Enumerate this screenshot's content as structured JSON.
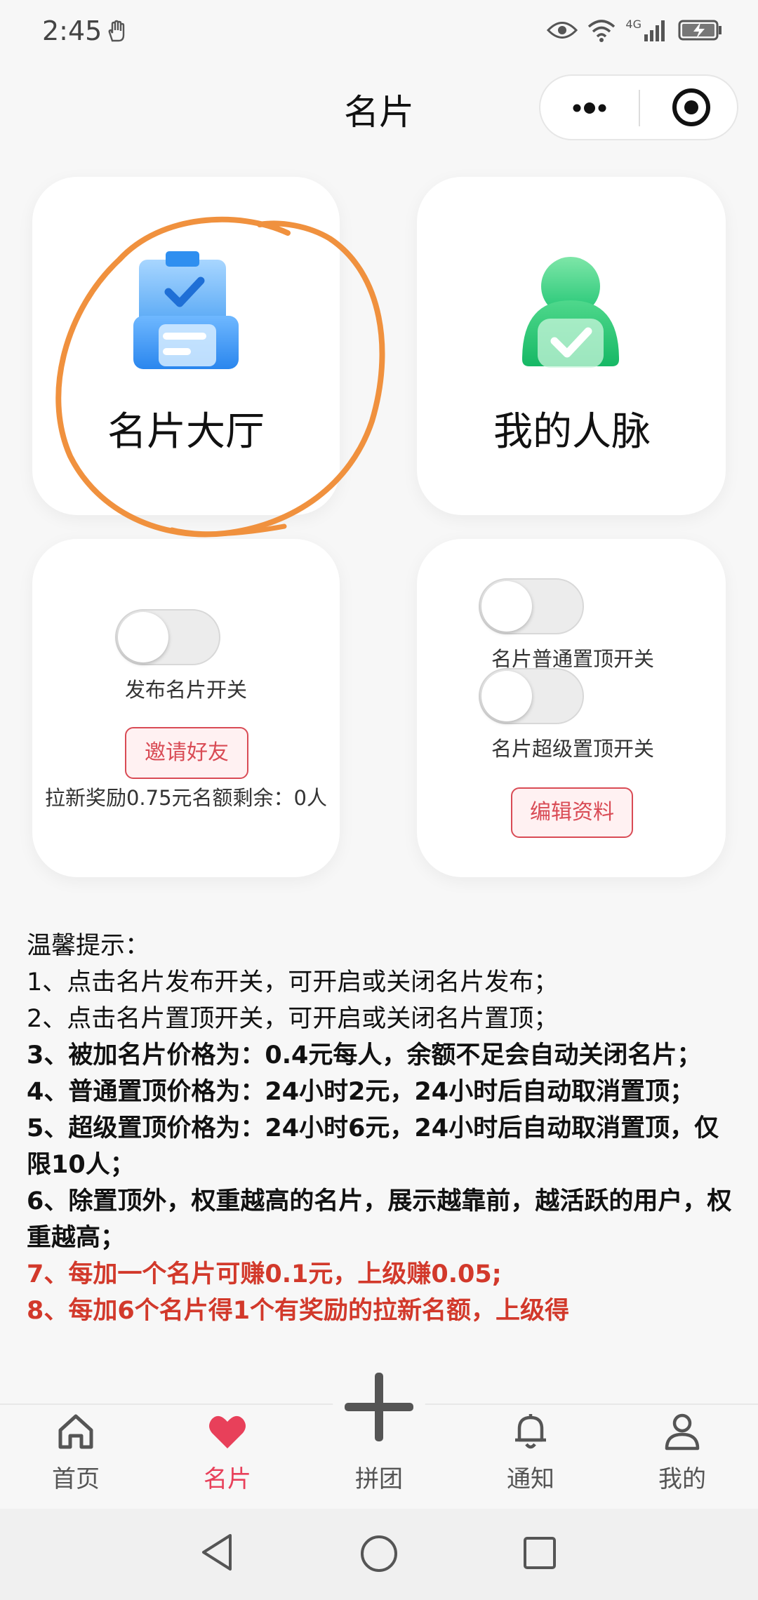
{
  "status": {
    "time": "2:45",
    "network": "4G"
  },
  "title": "名片",
  "cards": {
    "hall_label": "名片大厅",
    "network_label": "我的人脉",
    "publish_toggle_label": "发布名片开关",
    "publish_toggle_on": false,
    "invite_button": "邀请好友",
    "invite_reward_text": "拉新奖励0.75元名额剩余：0人",
    "normal_pin_label": "名片普通置顶开关",
    "normal_pin_on": false,
    "super_pin_label": "名片超级置顶开关",
    "super_pin_on": false,
    "edit_button": "编辑资料"
  },
  "tips": {
    "heading": "温馨提示：",
    "lines": [
      "1、点击名片发布开关，可开启或关闭名片发布；",
      "2、点击名片置顶开关，可开启或关闭名片置顶；",
      "3、被加名片价格为：0.4元每人，余额不足会自动关闭名片；",
      "4、普通置顶价格为：24小时2元，24小时后自动取消置顶；",
      "5、超级置顶价格为：24小时6元，24小时后自动取消置顶，仅限10人；",
      "6、除置顶外，权重越高的名片，展示越靠前，越活跃的用户，权重越高；",
      "7、每加一个名片可赚0.1元，上级赚0.05;",
      "8、每加6个名片得1个有奖励的拉新名额，上级得"
    ]
  },
  "tabs": [
    {
      "label": "首页",
      "icon": "home-icon"
    },
    {
      "label": "名片",
      "icon": "heart-icon",
      "active": true
    },
    {
      "label": "拼团",
      "icon": "plus-icon"
    },
    {
      "label": "通知",
      "icon": "bell-icon"
    },
    {
      "label": "我的",
      "icon": "user-icon"
    }
  ],
  "colors": {
    "accent": "#e8405a",
    "warning_text": "#d2392b",
    "annotation": "#f0913e"
  }
}
